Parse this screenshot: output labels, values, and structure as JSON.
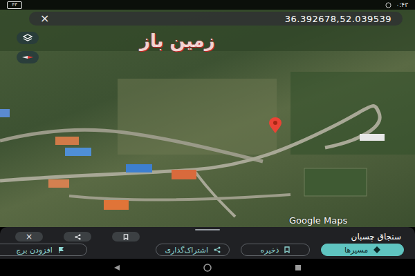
{
  "status_bar": {
    "battery": "۴۳",
    "time": "۰:۴۳"
  },
  "search": {
    "close": "×",
    "query": "36.392678,52.039539"
  },
  "map": {
    "watermark": "زمین باز",
    "attribution": "Google Maps"
  },
  "place": {
    "title": "سنجاق چسبان",
    "close": "×"
  },
  "actions": [
    {
      "label": "مسیرها",
      "primary": true,
      "kind": "directions"
    },
    {
      "label": "ذخیره",
      "primary": false,
      "kind": "save"
    },
    {
      "label": "اشتراک‌گذاری",
      "primary": false,
      "kind": "share"
    },
    {
      "label": "افزودن برچ",
      "primary": false,
      "kind": "label"
    }
  ]
}
